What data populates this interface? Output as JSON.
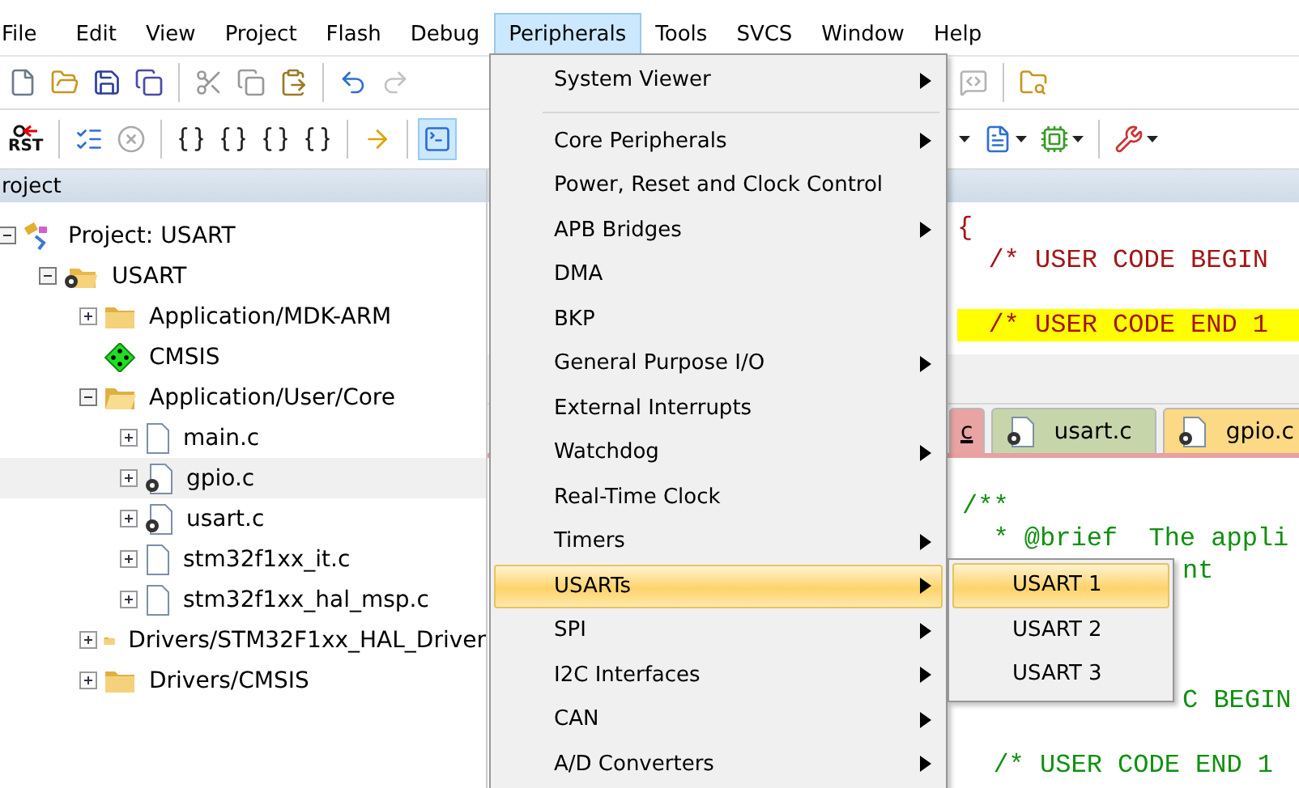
{
  "menubar": [
    {
      "label": "File",
      "selected": false
    },
    {
      "label": "Edit",
      "selected": false
    },
    {
      "label": "View",
      "selected": false
    },
    {
      "label": "Project",
      "selected": false
    },
    {
      "label": "Flash",
      "selected": false
    },
    {
      "label": "Debug",
      "selected": false
    },
    {
      "label": "Peripherals",
      "selected": true
    },
    {
      "label": "Tools",
      "selected": false
    },
    {
      "label": "SVCS",
      "selected": false
    },
    {
      "label": "Window",
      "selected": false
    },
    {
      "label": "Help",
      "selected": false
    }
  ],
  "toolbar_1": {
    "left": [
      {
        "kind": "new",
        "disabled": false
      },
      {
        "kind": "open",
        "disabled": false
      },
      {
        "kind": "save",
        "disabled": false
      },
      {
        "kind": "save-all",
        "disabled": false
      },
      {
        "kind": "sep"
      },
      {
        "kind": "cut",
        "disabled": true
      },
      {
        "kind": "copy",
        "disabled": true
      },
      {
        "kind": "paste",
        "disabled": false
      },
      {
        "kind": "sep"
      },
      {
        "kind": "undo",
        "disabled": false
      },
      {
        "kind": "redo",
        "disabled": true
      }
    ],
    "right": [
      {
        "kind": "comment",
        "disabled": true
      },
      {
        "kind": "sep"
      },
      {
        "kind": "find",
        "disabled": false
      }
    ]
  },
  "toolbar_2": {
    "left": [
      {
        "kind": "reset",
        "label": "RST",
        "disabled": false
      },
      {
        "kind": "sep"
      },
      {
        "kind": "list",
        "disabled": false
      },
      {
        "kind": "stop",
        "disabled": true
      },
      {
        "kind": "sep"
      },
      {
        "kind": "step-in",
        "disabled": false
      },
      {
        "kind": "step-over",
        "disabled": false
      },
      {
        "kind": "step-out",
        "disabled": false
      },
      {
        "kind": "run-to",
        "disabled": false
      },
      {
        "kind": "sep"
      },
      {
        "kind": "arrow",
        "disabled": false
      },
      {
        "kind": "sep"
      },
      {
        "kind": "window",
        "disabled": false,
        "pressed": true
      }
    ],
    "right": [
      {
        "kind": "caret"
      },
      {
        "kind": "view",
        "disabled": false,
        "dropdown": true
      },
      {
        "kind": "chip",
        "disabled": false,
        "dropdown": true
      },
      {
        "kind": "sep"
      },
      {
        "kind": "tools",
        "disabled": false,
        "dropdown": true
      }
    ]
  },
  "project_panel": {
    "title": "roject",
    "tree": [
      {
        "label": "Project: USART",
        "kind": "project",
        "expandable": true,
        "expanded": true,
        "selected": false,
        "children": [
          {
            "label": "USART",
            "kind": "target",
            "expandable": true,
            "expanded": true,
            "selected": false,
            "children": [
              {
                "label": "Application/MDK-ARM",
                "kind": "folder",
                "expandable": true,
                "expanded": false,
                "selected": false
              },
              {
                "label": "CMSIS",
                "kind": "component",
                "expandable": false,
                "selected": false
              },
              {
                "label": "Application/User/Core",
                "kind": "folder",
                "expandable": true,
                "expanded": true,
                "selected": false,
                "children": [
                  {
                    "label": "main.c",
                    "kind": "file",
                    "expandable": true,
                    "expanded": false,
                    "selected": false
                  },
                  {
                    "label": "gpio.c",
                    "kind": "file-options",
                    "expandable": true,
                    "expanded": false,
                    "selected": true
                  },
                  {
                    "label": "usart.c",
                    "kind": "file-options",
                    "expandable": true,
                    "expanded": false,
                    "selected": false
                  },
                  {
                    "label": "stm32f1xx_it.c",
                    "kind": "file",
                    "expandable": true,
                    "expanded": false,
                    "selected": false
                  },
                  {
                    "label": "stm32f1xx_hal_msp.c",
                    "kind": "file",
                    "expandable": true,
                    "expanded": false,
                    "selected": false
                  }
                ]
              },
              {
                "label": "Drivers/STM32F1xx_HAL_Driver",
                "kind": "folder",
                "expandable": true,
                "expanded": false,
                "selected": false
              },
              {
                "label": "Drivers/CMSIS",
                "kind": "folder",
                "expandable": true,
                "expanded": false,
                "selected": false
              }
            ]
          }
        ]
      }
    ]
  },
  "editor_top": {
    "lines": [
      {
        "text": "{",
        "highlight": false
      },
      {
        "text": "  /* USER CODE BEGIN",
        "highlight": false
      },
      {
        "highlight": false
      },
      {
        "text": "  /* USER CODE END 1",
        "highlight": true
      }
    ]
  },
  "editor_tabs": [
    {
      "label": "c",
      "color": "#eaa3a3",
      "selected": true,
      "kind": "plain"
    },
    {
      "label": "usart.c",
      "color": "#c7d5aa",
      "selected": false,
      "kind": "options"
    },
    {
      "label": "gpio.c",
      "color": "#fbd985",
      "selected": false,
      "kind": "options"
    }
  ],
  "editor_bottom": {
    "lines": [
      {
        "kind": "code",
        "text": "/**"
      },
      {
        "kind": "code",
        "text": "  * @brief  The appli"
      },
      {
        "kind": "fragment",
        "text": "nt"
      },
      {
        "kind": "blank"
      },
      {
        "kind": "blank"
      },
      {
        "kind": "blank"
      },
      {
        "kind": "fragment",
        "text": "C BEGIN"
      },
      {
        "kind": "blank"
      },
      {
        "kind": "code",
        "text": "  /* USER CODE END 1"
      }
    ]
  },
  "peripherals_menu": [
    {
      "kind": "item",
      "label": "System Viewer",
      "submenu": true,
      "selected": false
    },
    {
      "kind": "separator"
    },
    {
      "kind": "item",
      "label": "Core Peripherals",
      "submenu": true,
      "selected": false
    },
    {
      "kind": "item",
      "label": "Power, Reset and Clock Control",
      "submenu": false,
      "selected": false
    },
    {
      "kind": "item",
      "label": "APB Bridges",
      "submenu": true,
      "selected": false
    },
    {
      "kind": "item",
      "label": "DMA",
      "submenu": false,
      "selected": false
    },
    {
      "kind": "item",
      "label": "BKP",
      "submenu": false,
      "selected": false
    },
    {
      "kind": "item",
      "label": "General Purpose I/O",
      "submenu": true,
      "selected": false
    },
    {
      "kind": "item",
      "label": "External Interrupts",
      "submenu": false,
      "selected": false
    },
    {
      "kind": "item",
      "label": "Watchdog",
      "submenu": true,
      "selected": false
    },
    {
      "kind": "item",
      "label": "Real-Time Clock",
      "submenu": false,
      "selected": false
    },
    {
      "kind": "item",
      "label": "Timers",
      "submenu": true,
      "selected": false
    },
    {
      "kind": "item",
      "label": "USARTs",
      "submenu": true,
      "selected": true
    },
    {
      "kind": "item",
      "label": "SPI",
      "submenu": true,
      "selected": false
    },
    {
      "kind": "item",
      "label": "I2C Interfaces",
      "submenu": true,
      "selected": false
    },
    {
      "kind": "item",
      "label": "CAN",
      "submenu": true,
      "selected": false
    },
    {
      "kind": "item",
      "label": "A/D Converters",
      "submenu": true,
      "selected": false
    }
  ],
  "usart_submenu": [
    {
      "label": "USART 1",
      "selected": true
    },
    {
      "label": "USART 2",
      "selected": false
    },
    {
      "label": "USART 3",
      "selected": false
    }
  ]
}
